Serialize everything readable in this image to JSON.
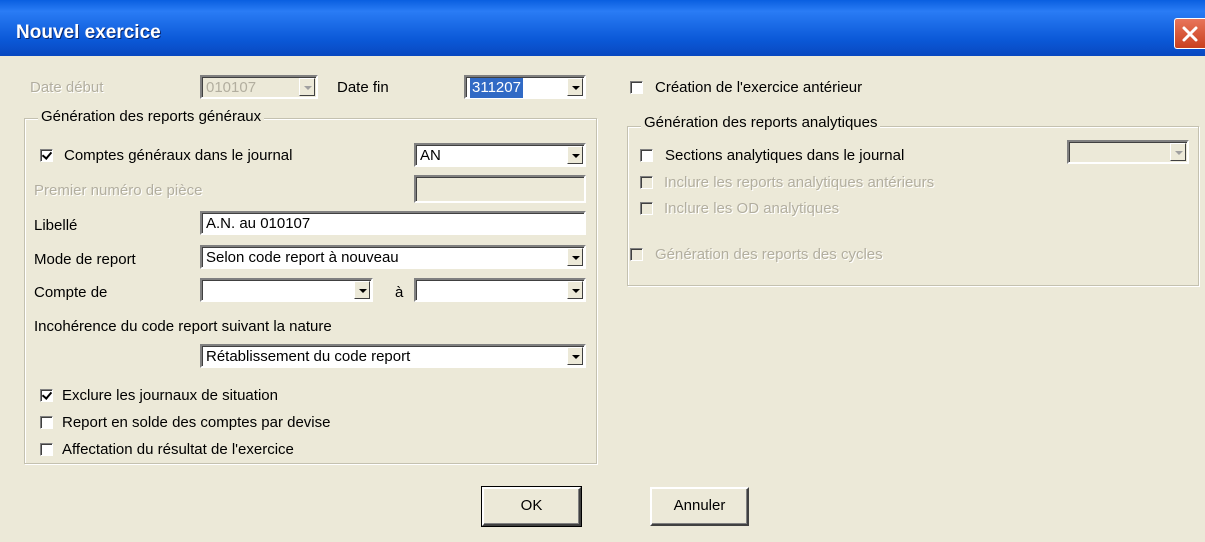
{
  "window": {
    "title": "Nouvel exercice"
  },
  "dates": {
    "start_label": "Date début",
    "start_value": "010107",
    "end_label": "Date fin",
    "end_value": "311207"
  },
  "general": {
    "group_title": "Génération des reports généraux",
    "comptes_label": "Comptes généraux dans le journal",
    "comptes_checked": true,
    "journal_value": "AN",
    "premier_numero_label": "Premier numéro de pièce",
    "libelle_label": "Libellé",
    "libelle_value": "A.N. au 010107",
    "mode_label": "Mode de report",
    "mode_value": "Selon code report à nouveau",
    "compte_de_label": "Compte de",
    "compte_a_label": "à",
    "incoherence_label": "Incohérence du code report suivant la nature",
    "incoherence_value": "Rétablissement du code report",
    "exclure_label": "Exclure les journaux de situation",
    "exclure_checked": true,
    "report_devise_label": "Report en solde des comptes par devise",
    "report_devise_checked": false,
    "affectation_label": "Affectation du résultat de l'exercice",
    "affectation_checked": false
  },
  "anterior": {
    "label": "Création de l'exercice antérieur",
    "checked": false
  },
  "analytic": {
    "group_title": "Génération des reports analytiques",
    "sections_label": "Sections analytiques dans le journal",
    "sections_checked": false,
    "inclure_anterieurs_label": "Inclure les reports analytiques antérieurs",
    "inclure_od_label": "Inclure les OD analytiques"
  },
  "cycles": {
    "label": "Génération des reports des cycles"
  },
  "buttons": {
    "ok": "OK",
    "cancel": "Annuler"
  }
}
